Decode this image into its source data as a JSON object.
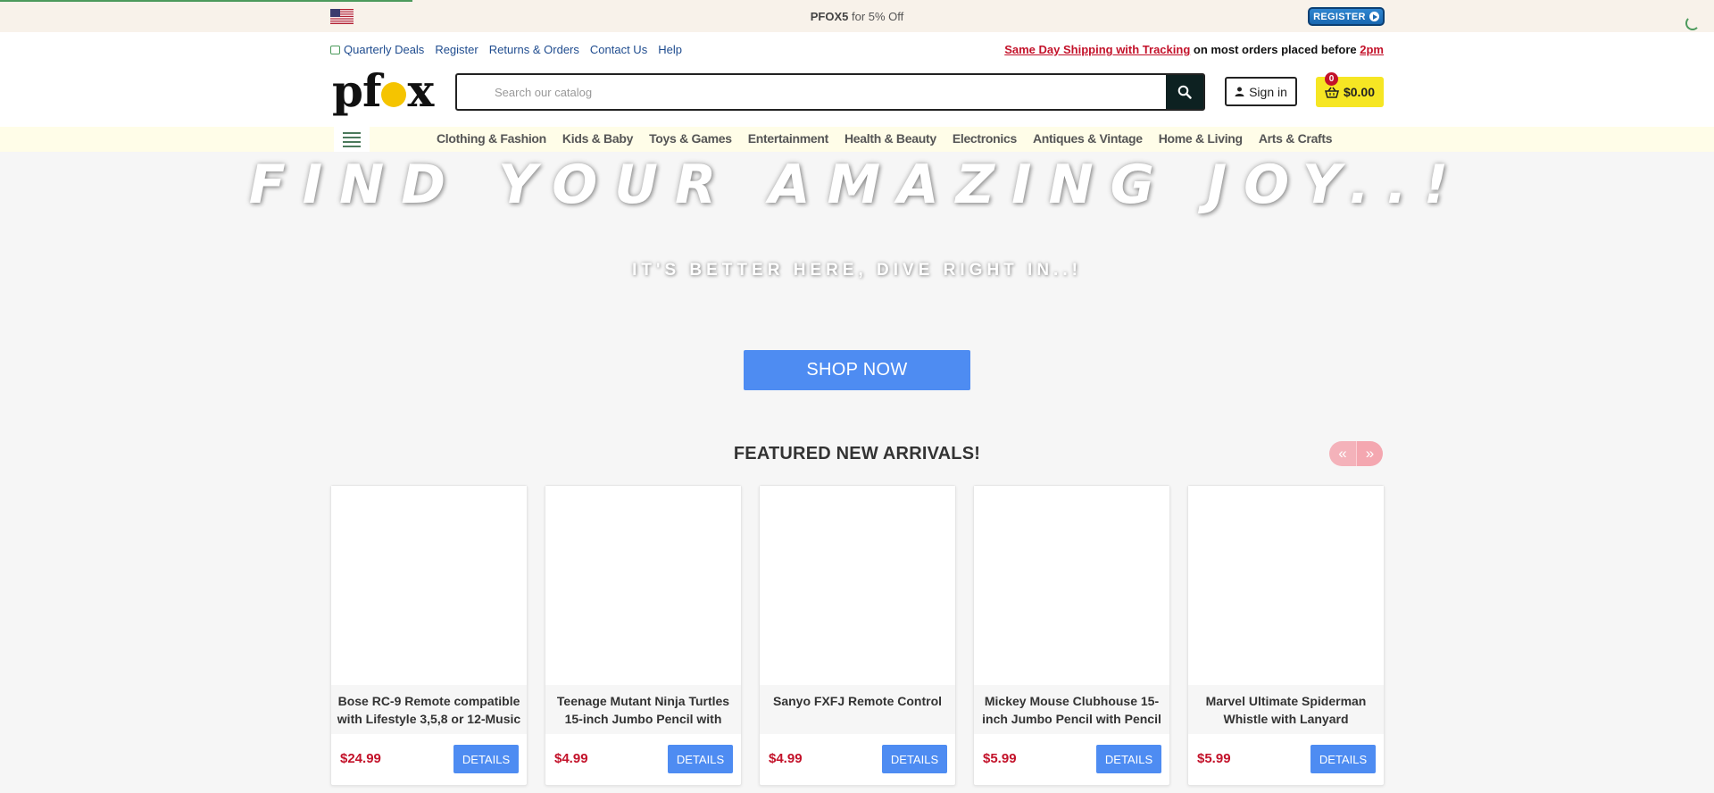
{
  "promo": {
    "code": "PFOX5",
    "text": " for 5% Off",
    "register_badge": "REGISTER"
  },
  "header": {
    "util_links": [
      "Quarterly Deals",
      "Register",
      "Returns & Orders",
      "Contact Us",
      "Help"
    ],
    "shipping": {
      "link": "Same Day Shipping with Tracking",
      "middle": " on most orders placed before ",
      "time": "2pm"
    },
    "logo": {
      "p": "p",
      "f": "f",
      "x": "x"
    },
    "search": {
      "placeholder": "Search our catalog"
    },
    "signin_label": "Sign in",
    "cart": {
      "count": "0",
      "total": "$0.00"
    }
  },
  "categories": [
    "Clothing & Fashion",
    "Kids & Baby",
    "Toys & Games",
    "Entertainment",
    "Health & Beauty",
    "Electronics",
    "Antiques & Vintage",
    "Home & Living",
    "Arts & Crafts"
  ],
  "hero": {
    "title": "FIND YOUR AMAZING JOY..!",
    "subtitle": "IT'S BETTER HERE, DIVE RIGHT IN..!",
    "cta": "SHOP NOW"
  },
  "featured": {
    "title": "FEATURED NEW ARRIVALS!",
    "prev_icon": "«",
    "next_icon": "»",
    "products": [
      {
        "name": "Bose RC-9 Remote compatible with Lifestyle 3,5,8 or 12-Music",
        "price": "$24.99",
        "button": "DETAILS"
      },
      {
        "name": "Teenage Mutant Ninja Turtles 15-inch Jumbo Pencil with",
        "price": "$4.99",
        "button": "DETAILS"
      },
      {
        "name": "Sanyo FXFJ Remote Control",
        "price": "$4.99",
        "button": "DETAILS"
      },
      {
        "name": "Mickey Mouse Clubhouse 15-inch Jumbo Pencil with Pencil",
        "price": "$5.99",
        "button": "DETAILS"
      },
      {
        "name": "Marvel Ultimate Spiderman Whistle with Lanyard",
        "price": "$5.99",
        "button": "DETAILS"
      }
    ]
  },
  "colors": {
    "accent_blue": "#4e8cf2",
    "price_red": "#c3122a",
    "cart_yellow": "#f6e623",
    "promo_bg": "#f8f2ea",
    "nav_bg": "#fffde8"
  },
  "icons": {
    "flag": "us-flag-icon",
    "search": "search-icon",
    "user": "user-icon",
    "cart": "basket-icon",
    "menu": "hamburger-menu-icon"
  }
}
